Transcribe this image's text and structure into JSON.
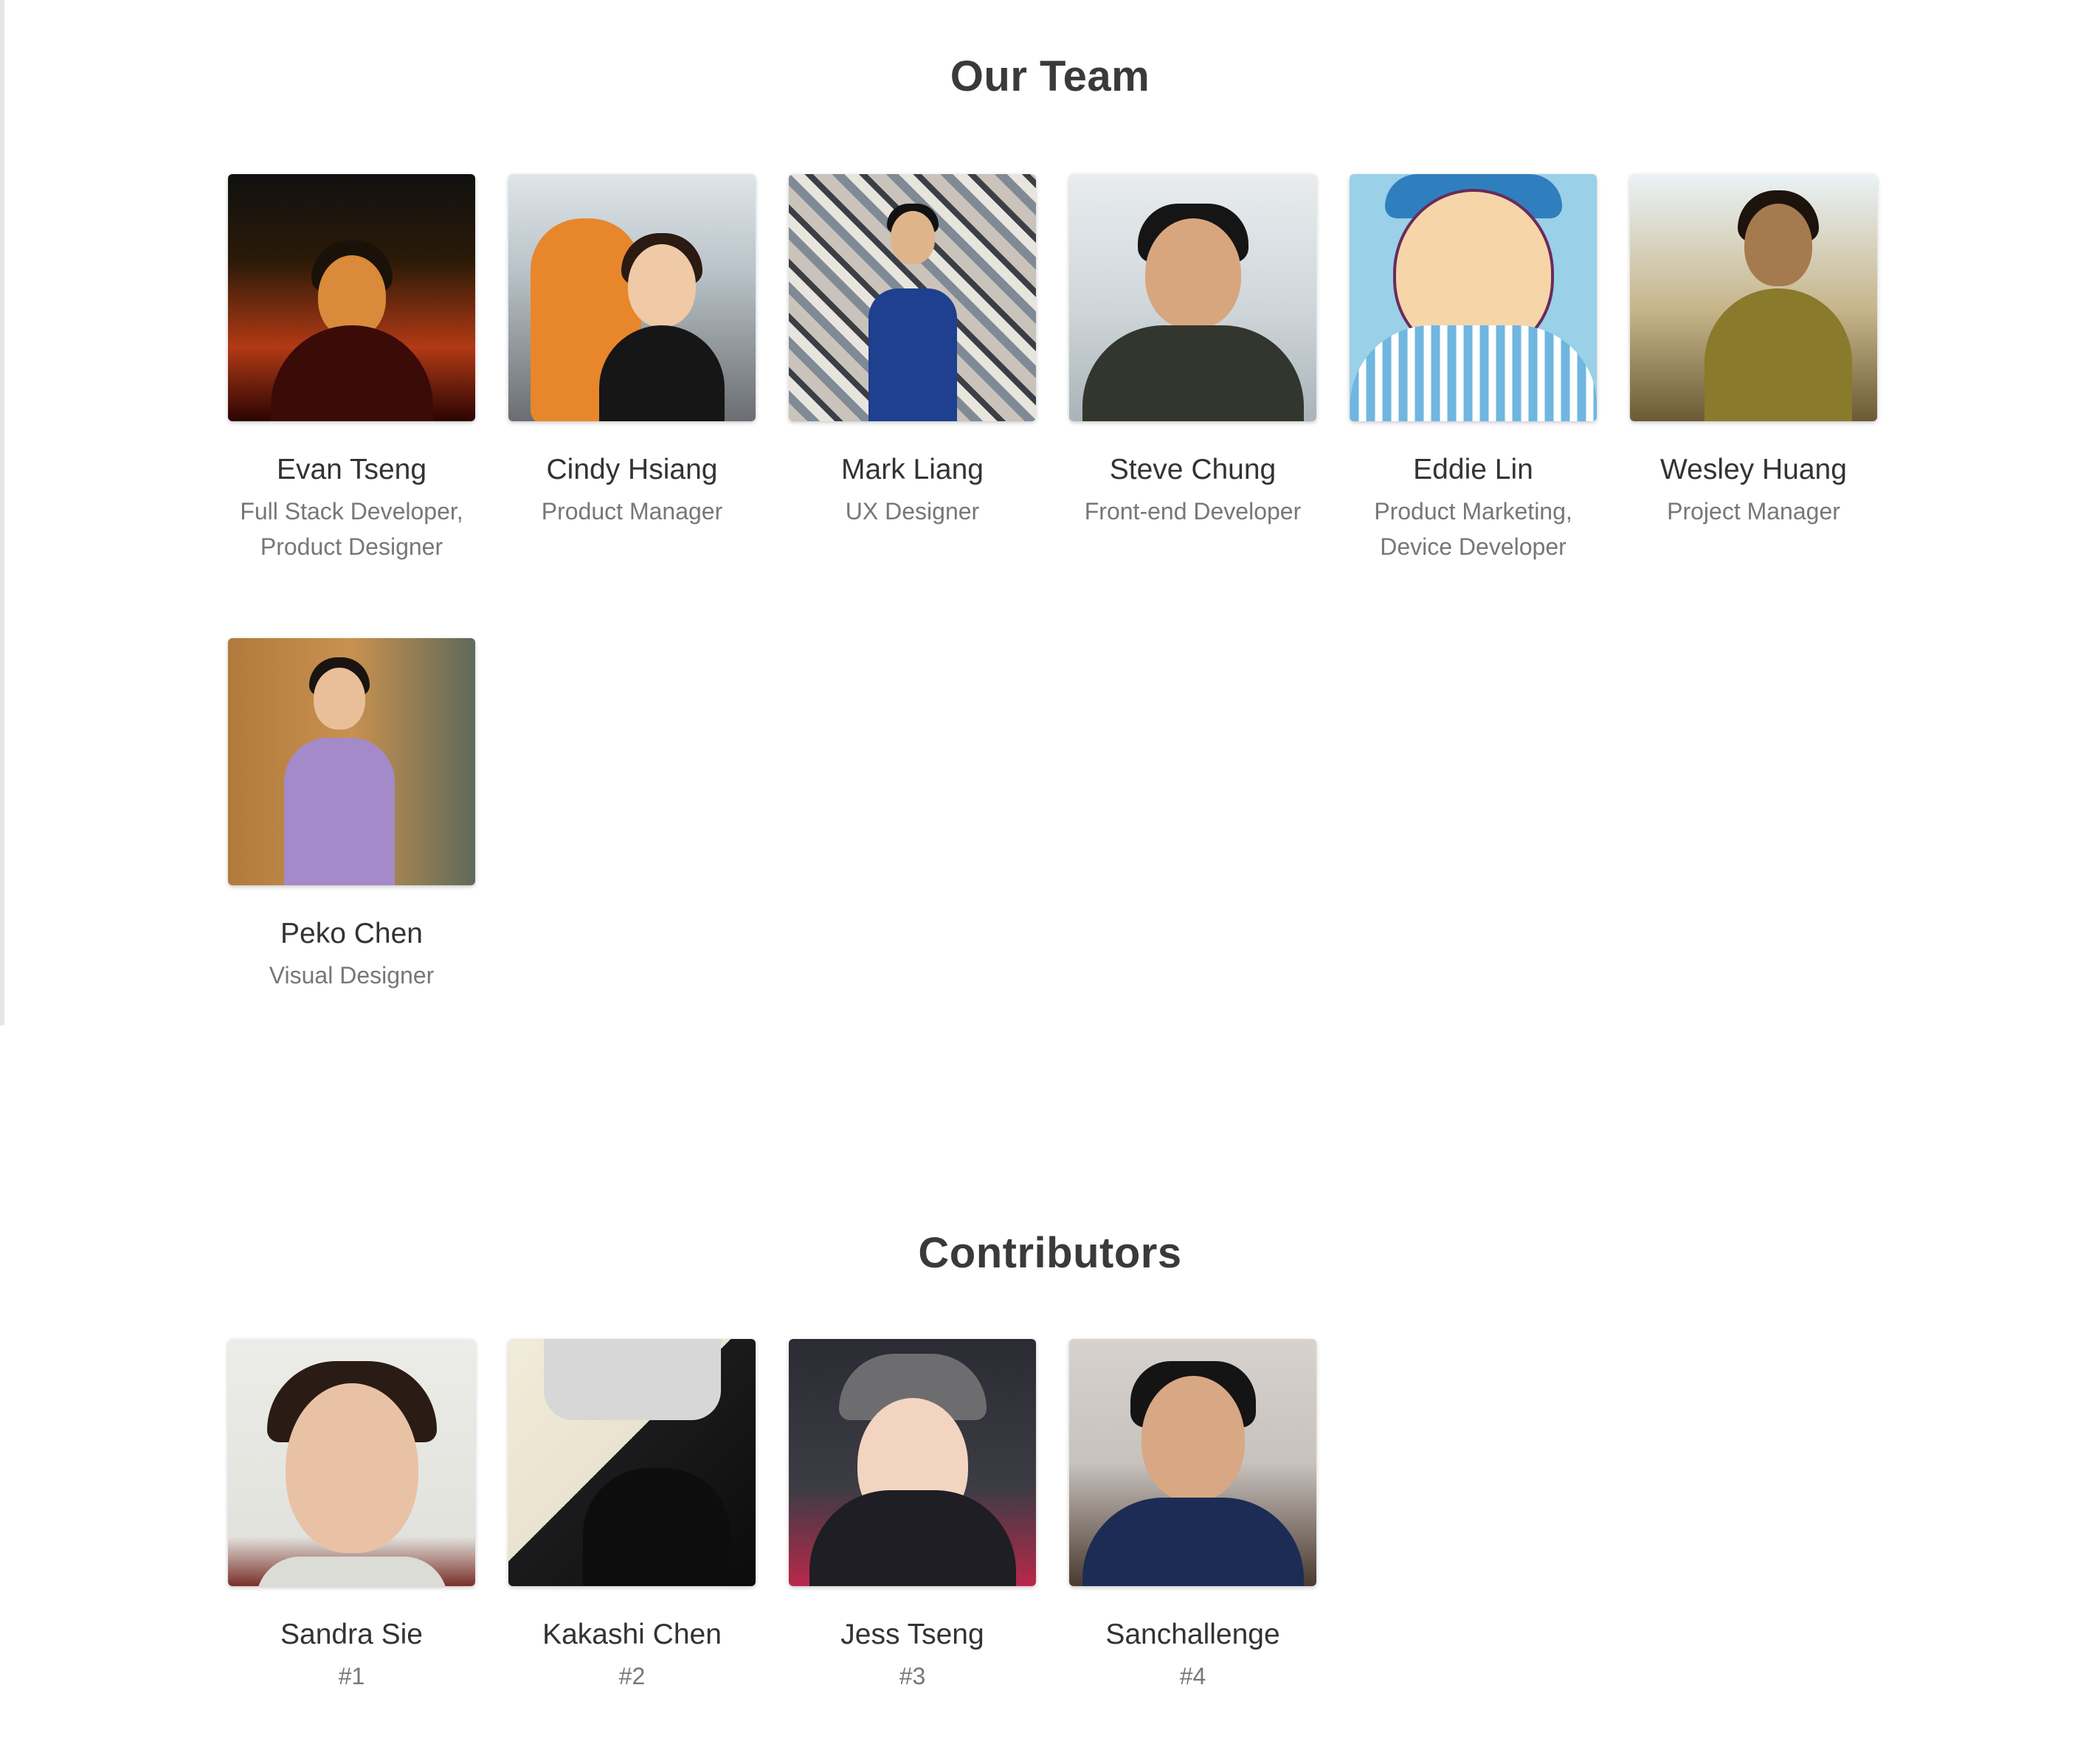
{
  "team": {
    "title": "Our Team",
    "members": [
      {
        "name": "Evan Tseng",
        "role_line1": "Full Stack Developer,",
        "role_line2": "Product Designer"
      },
      {
        "name": "Cindy Hsiang",
        "role_line1": "Product Manager",
        "role_line2": ""
      },
      {
        "name": "Mark Liang",
        "role_line1": "UX Designer",
        "role_line2": ""
      },
      {
        "name": "Steve Chung",
        "role_line1": "Front-end Developer",
        "role_line2": ""
      },
      {
        "name": "Eddie Lin",
        "role_line1": "Product Marketing,",
        "role_line2": "Device Developer"
      },
      {
        "name": "Wesley Huang",
        "role_line1": "Project Manager",
        "role_line2": ""
      },
      {
        "name": "Peko Chen",
        "role_line1": "Visual Designer",
        "role_line2": ""
      }
    ]
  },
  "contributors": {
    "title": "Contributors",
    "members": [
      {
        "name": "Sandra Sie",
        "rank": "#1"
      },
      {
        "name": "Kakashi Chen",
        "rank": "#2"
      },
      {
        "name": "Jess Tseng",
        "rank": "#3"
      },
      {
        "name": "Sanchallenge",
        "rank": "#4"
      }
    ]
  }
}
